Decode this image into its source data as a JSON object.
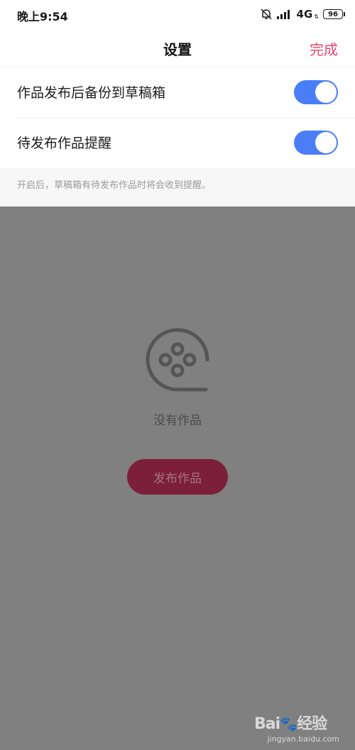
{
  "status_bar": {
    "time": "晚上9:54",
    "network": "4G",
    "battery": "96"
  },
  "nav": {
    "title": "设置",
    "done_label": "完成"
  },
  "settings": [
    {
      "label": "作品发布后备份到草稿箱",
      "enabled": true
    },
    {
      "label": "待发布作品提醒",
      "enabled": true
    }
  ],
  "hint": "开启后，草稿箱有待发布作品时将会收到提醒。",
  "empty_state": {
    "message": "没有作品",
    "button_label": "发布作品",
    "icon": "film-reel-icon"
  },
  "watermark": {
    "logo_text": "Bai 经验",
    "url": "jingyan.baidu.com"
  },
  "colors": {
    "accent": "#e8456c",
    "toggle_on": "#4a7ef7",
    "overlay": "#808080",
    "button": "#7c1f3a"
  }
}
